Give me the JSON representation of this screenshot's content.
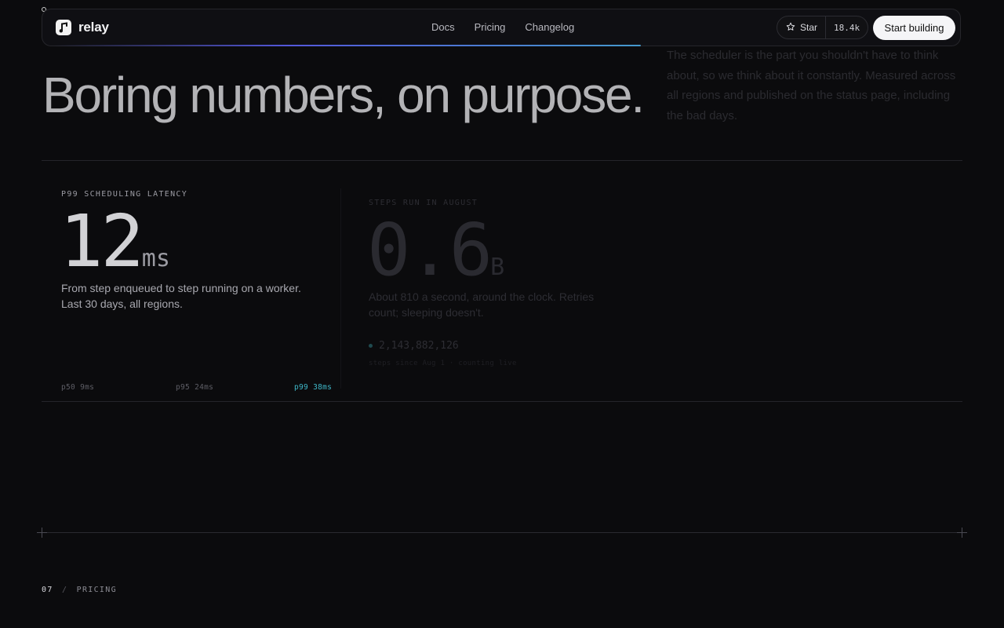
{
  "nav": {
    "brand": "relay",
    "links": [
      "Docs",
      "Pricing",
      "Changelog"
    ],
    "star_label": "Star",
    "star_count": "18.4k",
    "cta_label": "Start building"
  },
  "hero": {
    "headline": "Boring numbers, on purpose.",
    "intro": "The scheduler is the part you shouldn't have to think about, so we think about it constantly. Measured across all regions and published on the status page, including the bad days."
  },
  "stats": {
    "latency": {
      "label": "P99 SCHEDULING LATENCY",
      "value": "12",
      "unit": "ms",
      "description": "From step enqueued to step running on a worker. Last 30 days, all regions.",
      "percentiles": [
        {
          "label": "p50 9ms"
        },
        {
          "label": "p95 24ms"
        },
        {
          "label": "p99 38ms"
        }
      ]
    },
    "steps": {
      "label": "STEPS RUN IN AUGUST",
      "value": "0.6",
      "unit": "B",
      "description": "About 810 a second, around the clock. Retries count; sleeping doesn't.",
      "counter": "2,143,882,126",
      "counter_note": "steps since Aug 1 · counting live"
    }
  },
  "section": {
    "number": "07",
    "separator": "/",
    "name": "PRICING"
  },
  "colors": {
    "background": "#0b0b0d",
    "accent_p99": "#3fb8c9",
    "nav_progress_start": "#5a5ff0",
    "nav_progress_end": "#4aa7e0"
  }
}
